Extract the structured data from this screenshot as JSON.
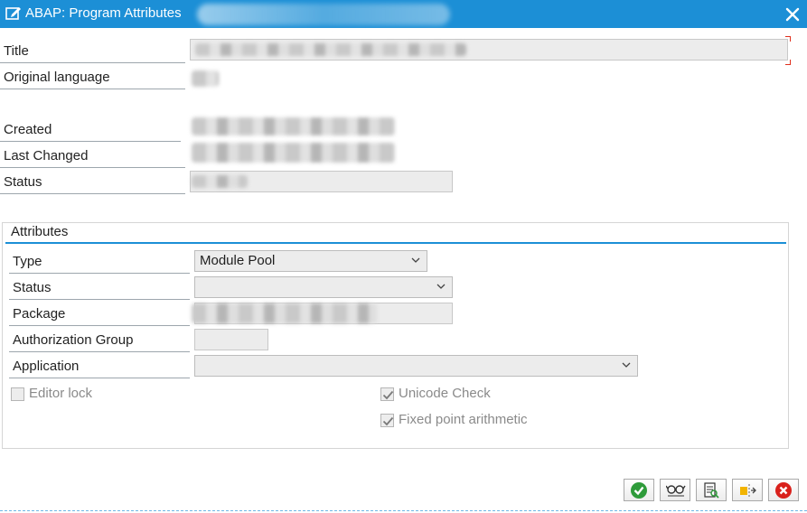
{
  "window": {
    "title": "ABAP: Program Attributes"
  },
  "header_fields": {
    "title_label": "Title",
    "original_language_label": "Original language",
    "created_label": "Created",
    "last_changed_label": "Last Changed",
    "status_label": "Status"
  },
  "attributes": {
    "group_title": "Attributes",
    "type_label": "Type",
    "type_value": "Module Pool",
    "status_label": "Status",
    "status_value": "",
    "package_label": "Package",
    "authorization_group_label": "Authorization Group",
    "application_label": "Application",
    "application_value": "",
    "editor_lock_label": "Editor lock",
    "editor_lock_checked": false,
    "unicode_check_label": "Unicode Check",
    "unicode_check_checked": true,
    "fixed_point_label": "Fixed point arithmetic",
    "fixed_point_checked": true
  },
  "toolbar": {
    "buttons": [
      {
        "icon": "check-icon"
      },
      {
        "icon": "glasses-icon"
      },
      {
        "icon": "documentation-icon"
      },
      {
        "icon": "export-icon"
      },
      {
        "icon": "cancel-icon"
      }
    ]
  },
  "colors": {
    "titlebar": "#1c8fd6",
    "accent_line": "#1c8fd6",
    "ok_green": "#2e9b3a",
    "cancel_red": "#d9211c"
  }
}
